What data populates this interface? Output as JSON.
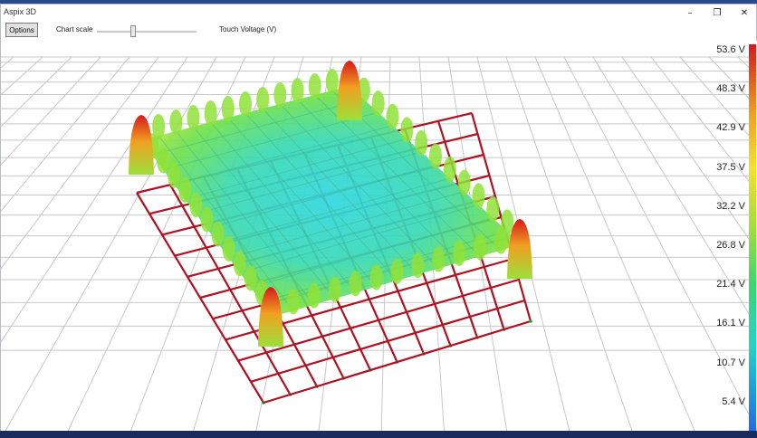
{
  "window": {
    "title": "Aspix 3D"
  },
  "window_controls": {
    "minimize": "–",
    "maximize": "❐",
    "close": "✕"
  },
  "toolbar": {
    "options_label": "Options",
    "chart_scale_label": "Chart scale",
    "chart_scale_value": 0.38,
    "touch_voltage_label": "Touch Voltage (V)"
  },
  "legend": {
    "labels": [
      "53.6 V",
      "48.3 V",
      "42.9 V",
      "37.5 V",
      "32.2 V",
      "26.8 V",
      "21.4 V",
      "16.1 V",
      "10.7 V",
      "5.4 V"
    ],
    "colors": [
      "#d7191c",
      "#f0a020",
      "#f5e12a",
      "#9be03a",
      "#3ad86a",
      "#22d3c8",
      "#1e6af0"
    ]
  },
  "colors": {
    "grid": "#c8c8c8",
    "conductor": "#b01020",
    "rod": "#23a030"
  }
}
